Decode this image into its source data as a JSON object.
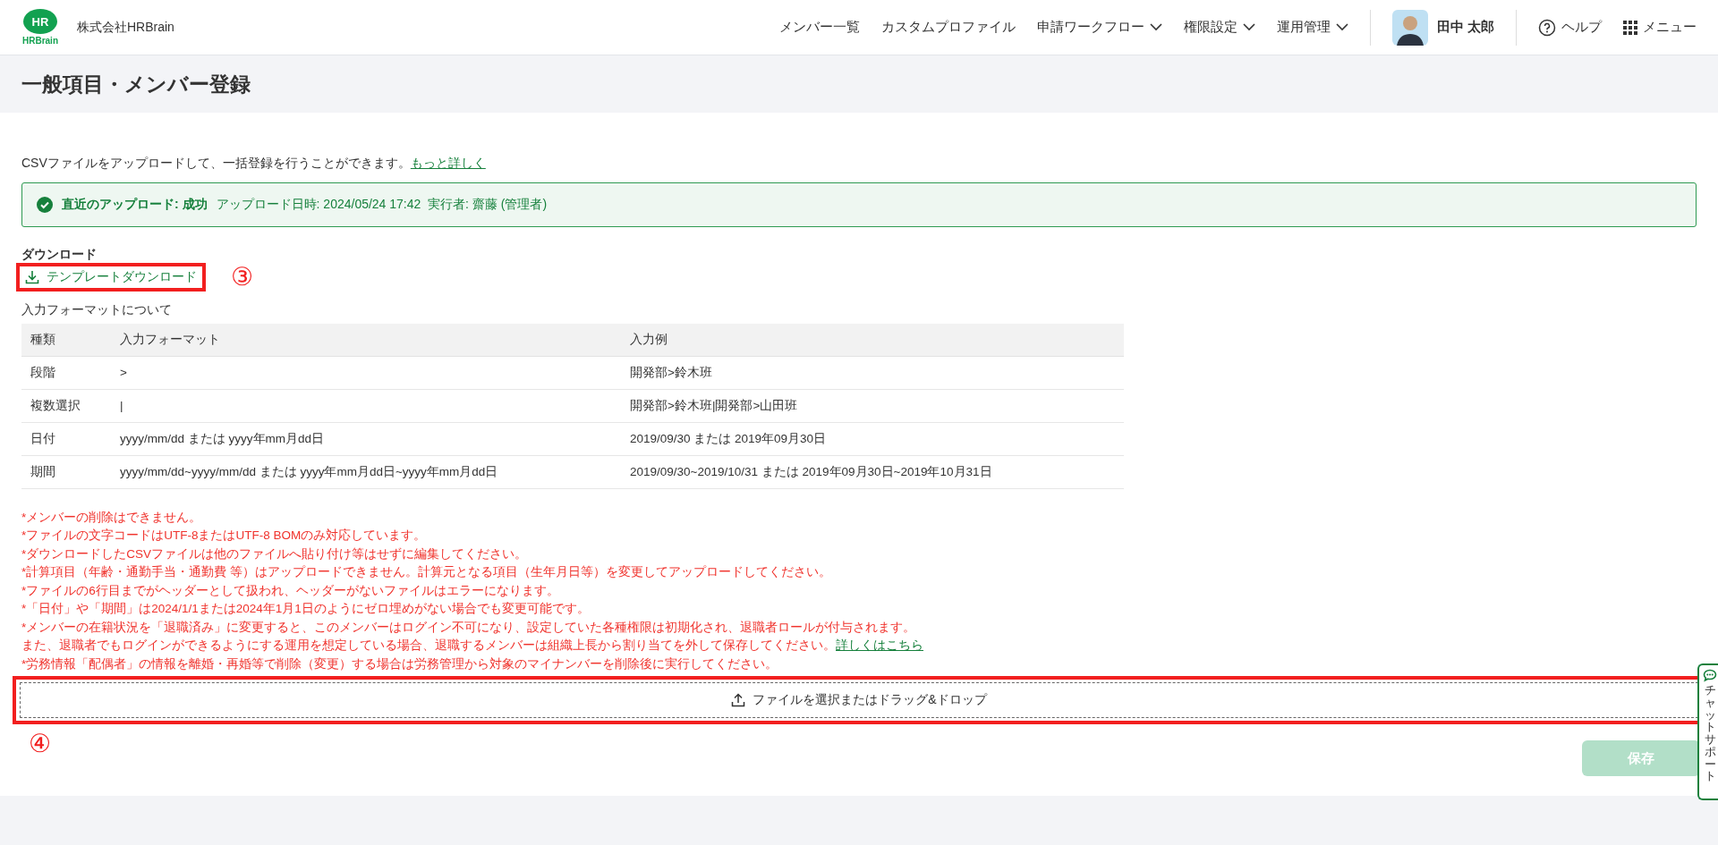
{
  "header": {
    "logo": {
      "mark": "HR",
      "wordmark": "HRBrain"
    },
    "company": "株式会社HRBrain",
    "nav": [
      {
        "label": "メンバー一覧",
        "kind": "link"
      },
      {
        "label": "カスタムプロファイル",
        "kind": "link"
      },
      {
        "label": "申請ワークフロー",
        "kind": "dropdown"
      },
      {
        "label": "権限設定",
        "kind": "dropdown"
      },
      {
        "label": "運用管理",
        "kind": "dropdown"
      }
    ],
    "user": "田中 太郎",
    "help": "ヘルプ",
    "menu": "メニュー"
  },
  "page_title": "一般項目・メンバー登録",
  "intro": {
    "text": "CSVファイルをアップロードして、一括登録を行うことができます。",
    "link": "もっと詳しく"
  },
  "alert": {
    "success": true,
    "title": "直近のアップロード: 成功",
    "detail": "アップロード日時: 2024/05/24 17:42  実行者: 齋藤 (管理者)"
  },
  "download": {
    "heading": "ダウンロード",
    "button": "テンプレートダウンロード",
    "annotation": "③"
  },
  "format": {
    "heading": "入力フォーマットについて",
    "columns": [
      "種類",
      "入力フォーマット",
      "入力例"
    ],
    "rows": [
      [
        "段階",
        ">",
        "開発部>鈴木班"
      ],
      [
        "複数選択",
        "|",
        "開発部>鈴木班|開発部>山田班"
      ],
      [
        "日付",
        "yyyy/mm/dd または yyyy年mm月dd日",
        "2019/09/30 または 2019年09月30日"
      ],
      [
        "期間",
        "yyyy/mm/dd~yyyy/mm/dd または yyyy年mm月dd日~yyyy年mm月dd日",
        "2019/09/30~2019/10/31 または 2019年09月30日~2019年10月31日"
      ]
    ]
  },
  "notes": [
    {
      "text": "*メンバーの削除はできません。"
    },
    {
      "text": "*ファイルの文字コードはUTF-8またはUTF-8 BOMのみ対応しています。"
    },
    {
      "text": "*ダウンロードしたCSVファイルは他のファイルへ貼り付け等はせずに編集してください。"
    },
    {
      "text": "*計算項目（年齢・通勤手当・通勤費 等）はアップロードできません。計算元となる項目（生年月日等）を変更してアップロードしてください。"
    },
    {
      "text": "*ファイルの6行目までがヘッダーとして扱われ、ヘッダーがないファイルはエラーになります。"
    },
    {
      "text": "*「日付」や「期間」は2024/1/1または2024年1月1日のようにゼロ埋めがない場合でも変更可能です。"
    },
    {
      "text": "*メンバーの在籍状況を「退職済み」に変更すると、このメンバーはログイン不可になり、設定していた各種権限は初期化され、退職者ロールが付与されます。"
    },
    {
      "text": "また、退職者でもログインができるようにする運用を想定している場合、退職するメンバーは組織上長から割り当てを外して保存してください。",
      "link": "詳しくはこちら"
    },
    {
      "text": "*労務情報「配偶者」の情報を離婚・再婚等で削除（変更）する場合は労務管理から対象のマイナンバーを削除後に実行してください。"
    }
  ],
  "upload": {
    "label": "ファイルを選択またはドラッグ&ドロップ",
    "annotation": "④"
  },
  "save": {
    "label": "保存",
    "disabled": true
  },
  "chat_support": "チャットサポート"
}
